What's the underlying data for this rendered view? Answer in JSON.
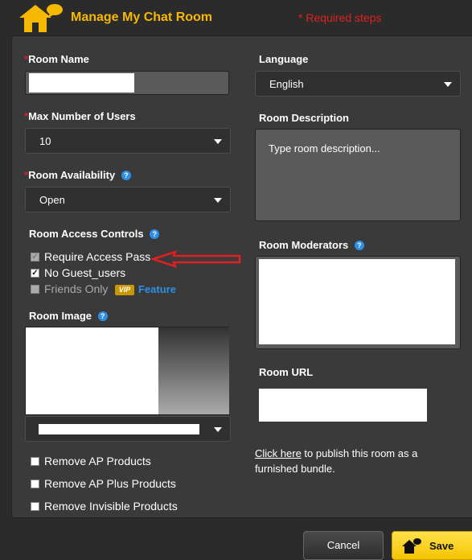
{
  "header": {
    "title": "Manage My Chat Room",
    "required_note": "* Required steps"
  },
  "left": {
    "room_name": {
      "label": "Room Name",
      "value": ""
    },
    "max_users": {
      "label": "Max Number of Users",
      "selected": "10"
    },
    "availability": {
      "label": "Room Availability",
      "selected": "Open"
    },
    "access_controls": {
      "label": "Room Access Controls",
      "items": [
        {
          "label": "Require Access Pass",
          "checked": true,
          "disabled": true
        },
        {
          "label": "No Guest_users",
          "checked": true,
          "disabled": false
        },
        {
          "label": "Friends Only",
          "checked": false,
          "disabled": true
        }
      ],
      "vip_badge": "VIP",
      "feature_link": "Feature"
    },
    "room_image": {
      "label": "Room Image",
      "selected": ""
    },
    "remove_options": [
      {
        "label": "Remove AP Products",
        "checked": false
      },
      {
        "label": "Remove AP Plus Products",
        "checked": false
      },
      {
        "label": "Remove Invisible Products",
        "checked": false
      }
    ]
  },
  "right": {
    "language": {
      "label": "Language",
      "selected": "English"
    },
    "description": {
      "label": "Room Description",
      "placeholder": "Type room description..."
    },
    "moderators": {
      "label": "Room Moderators"
    },
    "url": {
      "label": "Room URL",
      "value": ""
    },
    "publish": {
      "link": "Click here",
      "text": " to publish this room as a furnished bundle."
    }
  },
  "footer": {
    "cancel_label": "Cancel",
    "save_label": "Save"
  },
  "colors": {
    "accent": "#f6b800",
    "required": "#e02020",
    "help": "#2e8fe6",
    "panel": "#3a3a3a"
  }
}
